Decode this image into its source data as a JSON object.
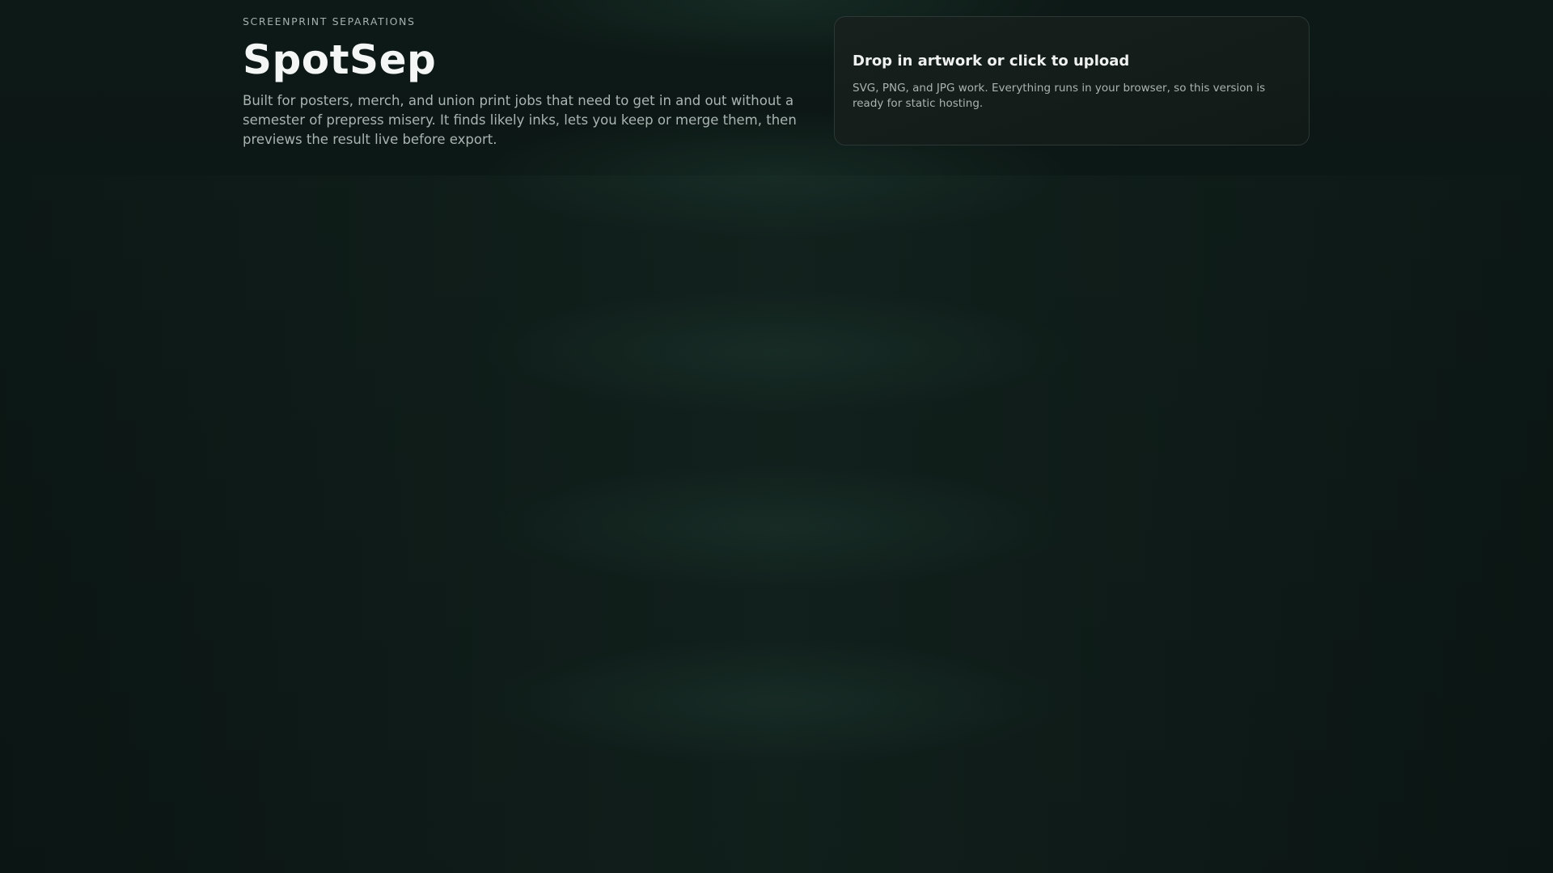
{
  "header": {
    "eyebrow": "SCREENPRINT SEPARATIONS",
    "title": "SpotSep",
    "subtitle": "Built for posters, merch, and union print jobs that need to get in and out without a semester of prepress misery. It finds likely inks, lets you keep or merge them, then previews the result live before export."
  },
  "upload": {
    "title": "Drop in artwork or click to upload",
    "description": "SVG, PNG, and JPG work. Everything runs in your browser, so this version is ready for static hosting."
  },
  "colors": {
    "background": "#0b1513",
    "card_background": "#161e1c",
    "card_border": "#2c3835",
    "text_primary": "#f4f6f5",
    "text_secondary": "#aab4b0"
  }
}
